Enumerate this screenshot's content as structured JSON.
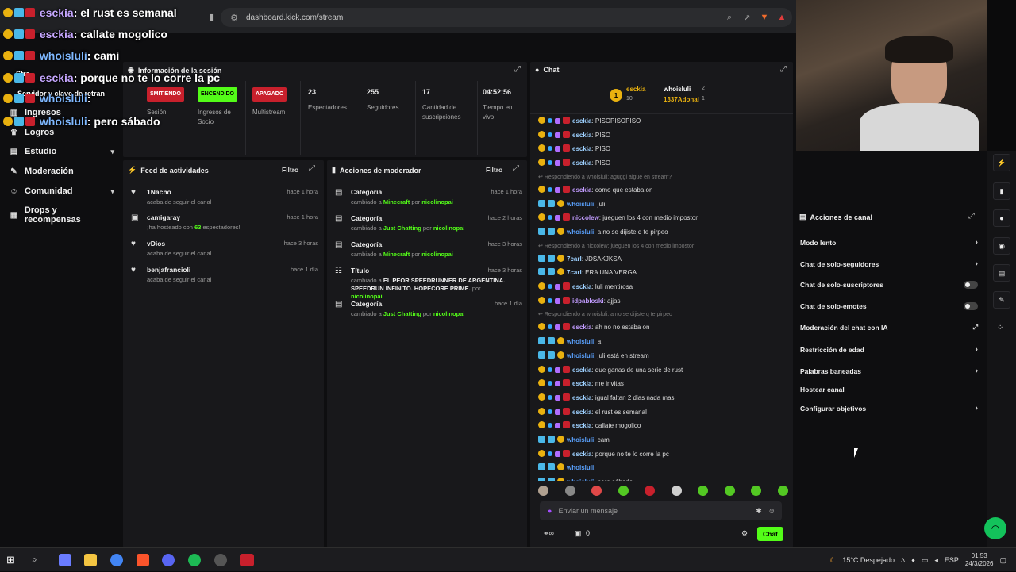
{
  "browser": {
    "url": "dashboard.kick.com/stream"
  },
  "overlay": {
    "lines": [
      {
        "user": "esckia",
        "text": "el rust es semanal"
      },
      {
        "user": "esckia",
        "text": "callate mogolico"
      },
      {
        "user": "whoisluli",
        "text": "cami"
      },
      {
        "user": "esckia",
        "text": "porque no te lo corre la pc"
      },
      {
        "user": "whoisluli",
        "text": ""
      },
      {
        "user": "whoisluli",
        "text": "pero sábado"
      }
    ],
    "partial_labels": [
      "Stre",
      "Servidor y clave de retran"
    ]
  },
  "sidebar": {
    "items": [
      {
        "label": "Ingresos",
        "icon": "bar-chart-icon"
      },
      {
        "label": "Logros",
        "icon": "trophy-icon"
      },
      {
        "label": "Estudio",
        "icon": "studio-icon"
      },
      {
        "label": "Moderación",
        "icon": "wrench-icon"
      },
      {
        "label": "Comunidad",
        "icon": "people-icon"
      },
      {
        "label": "Drops y recompensas",
        "icon": "gift-icon"
      }
    ]
  },
  "session": {
    "title": "Información de la sesión",
    "status_badge": "SMITIENDO",
    "status_label": "Sesión",
    "ingresos_badge": "ENCENDIDO",
    "ingresos_label": "Ingresos de Socio",
    "multistream_badge": "APAGADO",
    "multistream_label": "Multistream",
    "viewers": "23",
    "viewers_label": "Espectadores",
    "followers": "255",
    "followers_label": "Seguidores",
    "subs": "17",
    "subs_label": "Cantidad de suscripciones",
    "live_time": "04:52:56",
    "live_label": "Tiempo en vivo",
    "colors": {
      "red": "#c8202c",
      "green": "#53fc18"
    }
  },
  "feed": {
    "title": "Feed de actividades",
    "filter": "Filtro",
    "items": [
      {
        "name": "1Nacho",
        "desc": "acaba de seguir el canal",
        "time": "hace 1 hora"
      },
      {
        "name": "camigaray",
        "desc_pre": "¡ha hosteado con",
        "desc_num": "63",
        "desc_post": "espectadores!",
        "time": "hace 1 hora"
      },
      {
        "name": "vDios",
        "desc": "acaba de seguir el canal",
        "time": "hace 3 horas"
      },
      {
        "name": "benjafrancioli",
        "desc": "acaba de seguir el canal",
        "time": "hace 1 día"
      }
    ]
  },
  "mod": {
    "title": "Acciones de moderador",
    "filter": "Filtro",
    "items": [
      {
        "kind": "Categoría",
        "pre": "cambiado a",
        "value": "Minecraft",
        "by": "por",
        "user": "nicolinopai",
        "time": "hace 1 hora"
      },
      {
        "kind": "Categoría",
        "pre": "cambiado a",
        "value": "Just Chatting",
        "by": "por",
        "user": "nicolinopai",
        "time": "hace 2 horas"
      },
      {
        "kind": "Categoría",
        "pre": "cambiado a",
        "value": "Minecraft",
        "by": "por",
        "user": "nicolinopai",
        "time": "hace 3 horas"
      },
      {
        "kind": "Título",
        "pre": "cambiado a",
        "value": "EL PEOR SPEEDRUNNER DE ARGENTINA. SPEEDRUN INFINITO. HOPECORE PRIME.",
        "by": "por",
        "user": "nicolinopai",
        "time": "hace 3 horas"
      },
      {
        "kind": "Categoría",
        "pre": "cambiado a",
        "value": "Just Chatting",
        "by": "por",
        "user": "nicolinopai",
        "time": "hace 1 día"
      }
    ]
  },
  "chat": {
    "title": "Chat",
    "top": {
      "user1": "esckia",
      "user1_count": "10",
      "user2": "whoisluli",
      "user2_count": "2",
      "user3": "1337Adonai",
      "user3_count": "1",
      "rank": "1"
    },
    "messages": [
      {
        "type": "msg",
        "user": "esckia",
        "cls": "u3",
        "text": "PISOPISOPISO"
      },
      {
        "type": "msg",
        "user": "esckia",
        "cls": "u3",
        "text": "PISO"
      },
      {
        "type": "msg",
        "user": "esckia",
        "cls": "u3",
        "text": "PISO"
      },
      {
        "type": "msg",
        "user": "esckia",
        "cls": "u3",
        "text": "PISO"
      },
      {
        "type": "reply",
        "text": "Respondiendo a whoisluli: aguggi algue en stream?"
      },
      {
        "type": "msg",
        "user": "esckia",
        "cls": "u4",
        "text": "como que estaba on"
      },
      {
        "type": "msg",
        "user": "whoisluli",
        "cls": "u2",
        "text": "juli"
      },
      {
        "type": "msg",
        "user": "niccolew",
        "cls": "u4",
        "text": "jueguen los 4 con medio impostor"
      },
      {
        "type": "msg",
        "user": "whoisluli",
        "cls": "u2",
        "text": "a no se dijiste q te pirpeo"
      },
      {
        "type": "reply",
        "text": "Respondiendo a niccolew: jueguen los 4 con medio impostor"
      },
      {
        "type": "msg",
        "user": "7carl",
        "cls": "u3",
        "text": "JDSAKJKSA"
      },
      {
        "type": "msg",
        "user": "7carl",
        "cls": "u3",
        "text": "ERA UNA VERGA"
      },
      {
        "type": "msg",
        "user": "esckia",
        "cls": "u3",
        "text": "luli mentirosa"
      },
      {
        "type": "msg",
        "user": "idpabloski",
        "cls": "u4",
        "text": "ajjas"
      },
      {
        "type": "reply",
        "text": "Respondiendo a whoisluli: a no se dijiste q te pirpeo"
      },
      {
        "type": "msg",
        "user": "esckia",
        "cls": "u4",
        "text": "ah no no estaba on"
      },
      {
        "type": "msg",
        "user": "whoisluli",
        "cls": "u2",
        "text": "a"
      },
      {
        "type": "msg",
        "user": "whoisluli",
        "cls": "u2",
        "text": "juli está en stream"
      },
      {
        "type": "msg",
        "user": "esckia",
        "cls": "u3",
        "text": "que ganas de una serie de rust"
      },
      {
        "type": "msg",
        "user": "esckia",
        "cls": "u3",
        "text": "me invitas"
      },
      {
        "type": "msg",
        "user": "esckia",
        "cls": "u3",
        "text": "igual faltan 2 dias nada mas"
      },
      {
        "type": "msg",
        "user": "esckia",
        "cls": "u3",
        "text": "el rust es semanal"
      },
      {
        "type": "msg",
        "user": "esckia",
        "cls": "u3",
        "text": "callate mogolico"
      },
      {
        "type": "msg",
        "user": "whoisluli",
        "cls": "u2",
        "text": "cami"
      },
      {
        "type": "msg",
        "user": "esckia",
        "cls": "u3",
        "text": "porque no te lo corre la pc"
      },
      {
        "type": "msg",
        "user": "whoisluli",
        "cls": "u2",
        "text": ""
      },
      {
        "type": "msg",
        "user": "whoisluli",
        "cls": "u2",
        "text": "pero sábado"
      }
    ],
    "input_placeholder": "Enviar un mensaje",
    "send_label": "Chat",
    "points": "0"
  },
  "canal": {
    "title": "Acciones de canal",
    "items": [
      {
        "label": "Modo lento",
        "ctrl": "chevron"
      },
      {
        "label": "Chat de solo-seguidores",
        "ctrl": "chevron"
      },
      {
        "label": "Chat de solo-suscriptores",
        "ctrl": "toggle"
      },
      {
        "label": "Chat de solo-emotes",
        "ctrl": "toggle"
      },
      {
        "label": "Moderación del chat con IA",
        "ctrl": "external"
      },
      {
        "label": "Restricción de edad",
        "ctrl": "chevron"
      },
      {
        "label": "Palabras baneadas",
        "ctrl": "chevron"
      },
      {
        "label": "Hostear canal",
        "ctrl": "none"
      },
      {
        "label": "Configurar objetivos",
        "ctrl": "chevron"
      }
    ]
  },
  "taskbar": {
    "weather": "15°C Despejado",
    "lang": "ESP",
    "time": "01:53",
    "date": "24/3/2026"
  }
}
